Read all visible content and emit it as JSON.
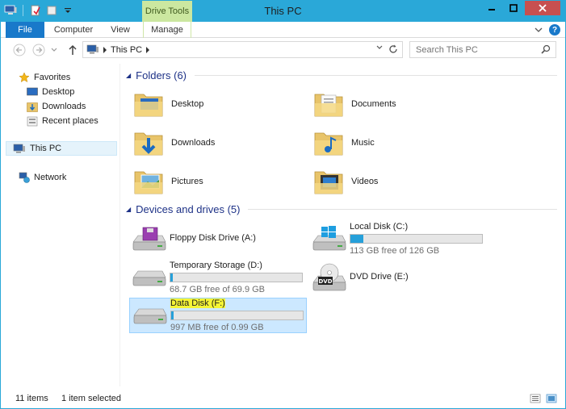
{
  "window": {
    "title": "This PC",
    "contextual_tab": "Drive Tools"
  },
  "ribbon": {
    "tabs": [
      {
        "label": "File"
      },
      {
        "label": "Computer"
      },
      {
        "label": "View"
      },
      {
        "label": "Manage"
      }
    ]
  },
  "address": {
    "path": [
      "This PC"
    ]
  },
  "search": {
    "placeholder": "Search This PC"
  },
  "navpane": {
    "favorites": {
      "label": "Favorites",
      "items": [
        {
          "label": "Desktop"
        },
        {
          "label": "Downloads"
        },
        {
          "label": "Recent places"
        }
      ]
    },
    "this_pc": {
      "label": "This PC"
    },
    "network": {
      "label": "Network"
    }
  },
  "folders": {
    "header": "Folders (6)",
    "items": [
      {
        "label": "Desktop",
        "icon": "desktop-folder-icon"
      },
      {
        "label": "Documents",
        "icon": "documents-folder-icon"
      },
      {
        "label": "Downloads",
        "icon": "downloads-folder-icon"
      },
      {
        "label": "Music",
        "icon": "music-folder-icon"
      },
      {
        "label": "Pictures",
        "icon": "pictures-folder-icon"
      },
      {
        "label": "Videos",
        "icon": "videos-folder-icon"
      }
    ]
  },
  "drives": {
    "header": "Devices and drives (5)",
    "items": [
      {
        "label": "Floppy Disk Drive (A:)",
        "icon": "floppy-drive-icon"
      },
      {
        "label": "Local Disk (C:)",
        "free": "113 GB free of 126 GB",
        "used_fraction": 0.1,
        "icon": "windows-drive-icon"
      },
      {
        "label": "Temporary Storage (D:)",
        "free": "68.7 GB free of 69.9 GB",
        "used_fraction": 0.02,
        "icon": "hard-drive-icon"
      },
      {
        "label": "DVD Drive (E:)",
        "icon": "dvd-drive-icon"
      },
      {
        "label": "Data Disk (F:)",
        "free": "997 MB free of 0.99 GB",
        "used_fraction": 0.02,
        "icon": "hard-drive-icon"
      }
    ]
  },
  "status": {
    "count": "11 items",
    "selected": "1 item selected"
  },
  "colors": {
    "titlebar": "#2aa8d8",
    "file_tab": "#1979ca",
    "drive_tools": "#cbe7a0",
    "close": "#c75050",
    "bar_fill": "#26a0da",
    "selection": "#cce8ff"
  }
}
